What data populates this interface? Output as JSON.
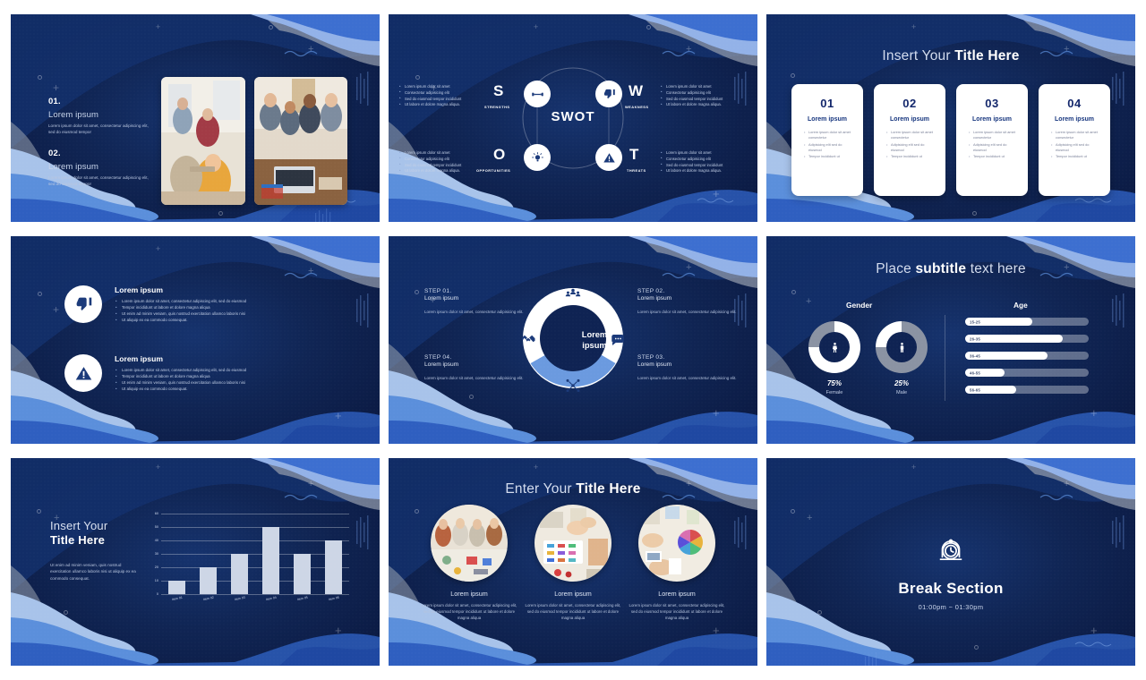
{
  "deck": {
    "slide1": {
      "items": [
        {
          "num": "01.",
          "heading": "Lorem ipsum",
          "body": "Lorem ipsum dolor sit amet, consectetur adipiscing elit, sed do eiusmod tempor"
        },
        {
          "num": "02.",
          "heading": "Lorem ipsum",
          "body": "Lorem ipsum dolor sit amet, consectetur adipiscing elit, sed do eiusmod tempor"
        }
      ],
      "photo1_alt": "team-meeting-photo",
      "photo2_alt": "team-collaboration-photo"
    },
    "slide2": {
      "center": "SWOT",
      "quadrants": [
        {
          "letter": "S",
          "label": "STRENGTHS",
          "icon": "dumbbell-icon",
          "bullets": [
            "Lorem ipsum dolor sit amet",
            "Consectetur adipisicing elit",
            "Sed do eiusmod tempor incididunt",
            "Ut labore et dolore magna aliqua."
          ]
        },
        {
          "letter": "W",
          "label": "WEAKNESS",
          "icon": "thumbs-down-icon",
          "bullets": [
            "Lorem ipsum dolor sit amet",
            "Consectetur adipisicing elit",
            "Sed do eiusmod tempor incididunt",
            "Ut labore et dolore magna aliqua."
          ]
        },
        {
          "letter": "O",
          "label": "OPPORTUNITIES",
          "icon": "lightbulb-icon",
          "bullets": [
            "Lorem ipsum dolor sit amet",
            "Consectetur adipisicing elit",
            "Sed do eiusmod tempor incididunt",
            "Ut labore et dolore magna aliqua."
          ]
        },
        {
          "letter": "T",
          "label": "THREATS",
          "icon": "warning-triangle-icon",
          "bullets": [
            "Lorem ipsum dolor sit amet",
            "Consectetur adipisicing elit",
            "Sed do eiusmod tempor incididunt",
            "Ut labore et dolore magna aliqua."
          ]
        }
      ]
    },
    "slide3": {
      "title_light": "Insert Your ",
      "title_bold": "Title Here",
      "cards": [
        {
          "num": "01",
          "heading": "Lorem ipsum",
          "bullets": [
            "Lorem ipsum dolor sit amet consectetur",
            "Adipisicing elit sed do eiusmod",
            "Tempor incididunt ut"
          ]
        },
        {
          "num": "02",
          "heading": "Lorem ipsum",
          "bullets": [
            "Lorem ipsum dolor sit amet consectetur",
            "Adipisicing elit sed do eiusmod",
            "Tempor incididunt ut"
          ]
        },
        {
          "num": "03",
          "heading": "Lorem ipsum",
          "bullets": [
            "Lorem ipsum dolor sit amet consectetur",
            "Adipisicing elit sed do eiusmod",
            "Tempor incididunt ut"
          ]
        },
        {
          "num": "04",
          "heading": "Lorem ipsum",
          "bullets": [
            "Lorem ipsum dolor sit amet consectetur",
            "Adipisicing elit sed do eiusmod",
            "Tempor incididunt ut"
          ]
        }
      ]
    },
    "slide4": {
      "rows": [
        {
          "icon": "thumbs-down-icon",
          "heading": "Lorem ipsum",
          "bullets": [
            "Lorem ipsum dolor sit amet, consectetur adipiscing elit, sed do eiusmod",
            "Tempor incididunt ut labore et dolore magna aliqua",
            "Ut enim ad minim veniam, quis nostrud exercitation ullamco laboris nisi",
            "Ut aliquip ex ea commodo consequat."
          ]
        },
        {
          "icon": "warning-triangle-icon",
          "heading": "Lorem ipsum",
          "bullets": [
            "Lorem ipsum dolor sit amet, consectetur adipiscing elit, sed do eiusmod",
            "Tempor incididunt ut labore et dolore magna aliqua",
            "Ut enim ad minim veniam, quis nostrud exercitation ullamco laboris nisi",
            "Ut aliquip ex ea commodo consequat."
          ]
        }
      ]
    },
    "slide5": {
      "center_line1": "Lorem",
      "center_line2": "ipsum",
      "steps": [
        {
          "label": "STEP 01.",
          "heading": "Lorem ipsum",
          "body": "Lorem ipsum dolor sit amet, consectetur adipisicing elit.",
          "icon": "people-group-icon"
        },
        {
          "label": "STEP 02.",
          "heading": "Lorem ipsum",
          "body": "Lorem ipsum dolor sit amet, consectetur adipisicing elit.",
          "icon": "chat-bubble-icon"
        },
        {
          "label": "STEP 03.",
          "heading": "Lorem ipsum",
          "body": "Lorem ipsum dolor sit amet, consectetur adipisicing elit.",
          "icon": "network-icon"
        },
        {
          "label": "STEP 04.",
          "heading": "Lorem ipsum",
          "body": "Lorem ipsum dolor sit amet, consectetur adipisicing elit.",
          "icon": "handshake-icon"
        }
      ]
    },
    "slide6": {
      "title_light_a": "Place ",
      "title_bold": "subtitle",
      "title_light_b": " text here",
      "gender_label": "Gender",
      "age_label": "Age",
      "donuts": [
        {
          "pct": "75%",
          "sub": "Female",
          "value": 75,
          "icon": "female-icon",
          "style": "light"
        },
        {
          "pct": "25%",
          "sub": "Male",
          "value": 25,
          "icon": "male-icon",
          "style": "dark"
        }
      ],
      "age_bars": [
        {
          "label": "15-25",
          "value": 54
        },
        {
          "label": "26-35",
          "value": 79
        },
        {
          "label": "36-45",
          "value": 67
        },
        {
          "label": "46-55",
          "value": 32
        },
        {
          "label": "56-65",
          "value": 41
        }
      ]
    },
    "slide7": {
      "title_light": "Insert Your",
      "title_bold": "Title Here",
      "body": "Ut enim ad minim veniam, quis nostrud exercitation ullamco laboris nisi ut aliquip ex ea commodo consequat.",
      "chart_data": {
        "type": "bar",
        "title": "",
        "categories": [
          "Item 01",
          "Item 02",
          "Item 03",
          "Item 04",
          "Item 05",
          "Item 06"
        ],
        "values": [
          10,
          20,
          30,
          50,
          30,
          40
        ],
        "yticks": [
          0,
          10,
          20,
          30,
          40,
          50,
          60
        ],
        "ylim": [
          0,
          60
        ],
        "xlabel": "",
        "ylabel": "",
        "grid": true,
        "legend": "none",
        "bar_color": "#cdd6e6"
      }
    },
    "slide8": {
      "title_light": "Enter Your ",
      "title_bold": "Title Here",
      "items": [
        {
          "heading": "Lorem ipsum",
          "body": "Lorem ipsum dolor sit amet, consectetur adipiscing elit, sed do eiusmod tempor incididunt ut labore et dolore magna aliqua",
          "photo_alt": "workshop-team-photo"
        },
        {
          "heading": "Lorem ipsum",
          "body": "Lorem ipsum dolor sit amet, consectetur adipiscing elit, sed do eiusmod tempor incididunt ut labore et dolore magna aliqua",
          "photo_alt": "design-materials-photo"
        },
        {
          "heading": "Lorem ipsum",
          "body": "Lorem ipsum dolor sit amet, consectetur adipiscing elit, sed do eiusmod tempor incididunt ut labore et dolore magna aliqua",
          "photo_alt": "color-wheel-desk-photo"
        }
      ]
    },
    "slide9": {
      "icon": "alarm-clock-icon",
      "heading": "Break Section",
      "subtitle": "01:00pm ~ 01:30pm"
    },
    "colors": {
      "bg_dark": "#0d1f50",
      "bg_mid": "#16336e",
      "wave_blue": "#2f5fc0",
      "wave_light_blue": "#6f9ae2",
      "wave_pale": "#a8c3ea",
      "wave_gray": "#8e97a8",
      "accent_white": "#ffffff",
      "card_text": "#16357e"
    }
  }
}
